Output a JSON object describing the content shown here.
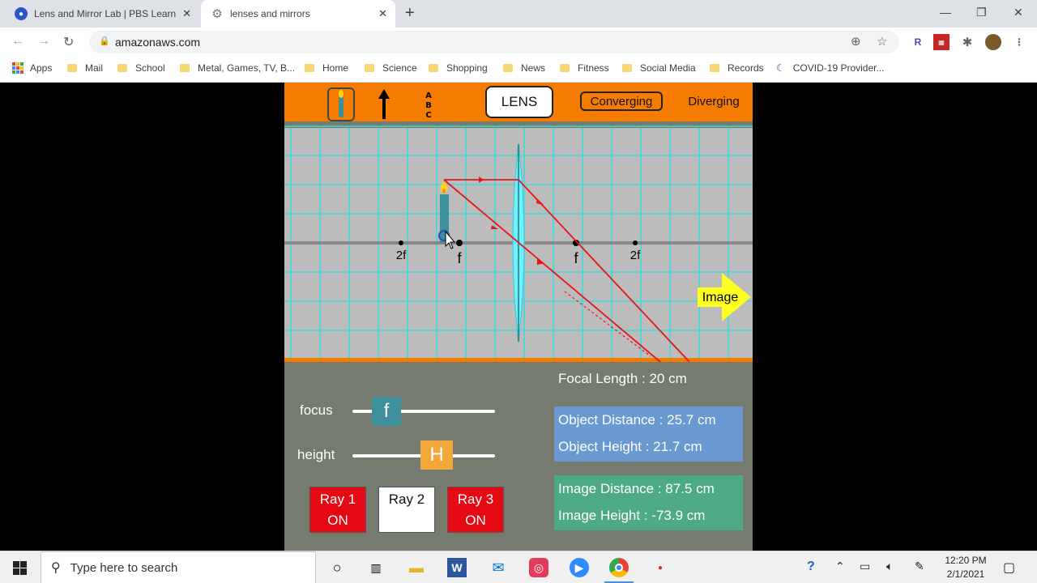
{
  "browser": {
    "tabs": [
      {
        "title": "Lens and Mirror Lab | PBS Learnin",
        "favicon": "pbs-icon",
        "active": false
      },
      {
        "title": "lenses and mirrors",
        "favicon": "gear-icon",
        "active": true
      }
    ],
    "url": "amazonaws.com",
    "bookmarks": [
      "Apps",
      "Mail",
      "School",
      "Metal, Games, TV, B...",
      "Home",
      "Science",
      "Shopping",
      "News",
      "Fitness",
      "Social Media",
      "Records",
      "COVID-19 Provider..."
    ]
  },
  "sim": {
    "toolbar": {
      "lens_label": "LENS",
      "converging_label": "Converging",
      "diverging_label": "Diverging",
      "tools": [
        "candle-icon",
        "arrow-icon",
        "abc-icon"
      ]
    },
    "stage": {
      "labels": {
        "f_left": "f",
        "f2_left": "2f",
        "f_right": "f",
        "f2_right": "2f"
      },
      "image_button": "Image"
    },
    "controls": {
      "focus_label": "focus",
      "focus_knob": "f",
      "height_label": "height",
      "height_knob": "H",
      "rays": [
        {
          "line1": "Ray 1",
          "line2": "ON",
          "on": true
        },
        {
          "line1": "Ray 2",
          "line2": "",
          "on": false
        },
        {
          "line1": "Ray 3",
          "line2": "ON",
          "on": true
        }
      ]
    },
    "info": {
      "focal_length": "Focal Length : 20 cm",
      "object_distance": "Object Distance : 25.7 cm",
      "object_height": "Object Height : 21.7 cm",
      "image_distance": "Image Distance : 87.5 cm",
      "image_height": "Image Height : -73.9 cm"
    },
    "colors": {
      "toolbar": "#f57c00",
      "ray": "#e8141a",
      "lens": "#6ff0ff",
      "grid": "#3fd9dc",
      "object_panel": "#6a98d0",
      "image_panel": "#4eaa86",
      "ray_on": "#e50914"
    }
  },
  "taskbar": {
    "search_placeholder": "Type here to search",
    "time": "12:20 PM",
    "date": "2/1/2021"
  }
}
